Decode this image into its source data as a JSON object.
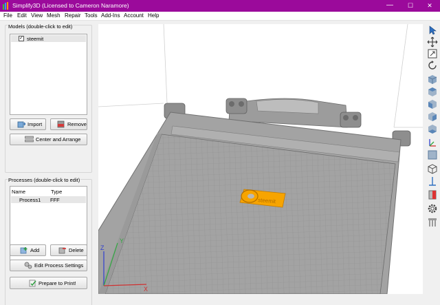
{
  "window": {
    "title": "Simplify3D (Licensed to Cameron Naramore)",
    "minimize_glyph": "—",
    "maximize_glyph": "☐",
    "close_glyph": "✕"
  },
  "menu": {
    "file": "File",
    "edit": "Edit",
    "view": "View",
    "mesh": "Mesh",
    "repair": "Repair",
    "tools": "Tools",
    "addins": "Add-Ins",
    "account": "Account",
    "help": "Help"
  },
  "models": {
    "title": "Models (double-click to edit)",
    "items": [
      {
        "name": "steemit",
        "checked": true
      }
    ],
    "import_label": "Import",
    "remove_label": "Remove",
    "center_label": "Center and Arrange"
  },
  "processes": {
    "title": "Processes (double-click to edit)",
    "columns": [
      "Name",
      "Type"
    ],
    "rows": [
      {
        "name": "Process1",
        "type": "FFF"
      }
    ],
    "add_label": "Add",
    "delete_label": "Delete",
    "edit_label": "Edit Process Settings",
    "print_label": "Prepare to Print!"
  },
  "viewport": {
    "model_text": "steemit",
    "bed_color": "#a3a3a3",
    "grid_color": "#8f8f8f",
    "model_color": "#f7a400",
    "axes": {
      "x": "X",
      "y": "Y",
      "z": "Z"
    }
  },
  "toolbar": [
    "select-arrow-icon",
    "move-icon",
    "scale-icon",
    "rotate-icon",
    "view-cube-default-icon",
    "view-cube-top-icon",
    "view-cube-front-icon",
    "view-cube-side-icon",
    "view-cube-bottom-icon",
    "axes-icon",
    "build-volume-icon",
    "wireframe-icon",
    "cross-section-icon",
    "shading-icon",
    "settings-gear-icon",
    "supports-icon"
  ]
}
